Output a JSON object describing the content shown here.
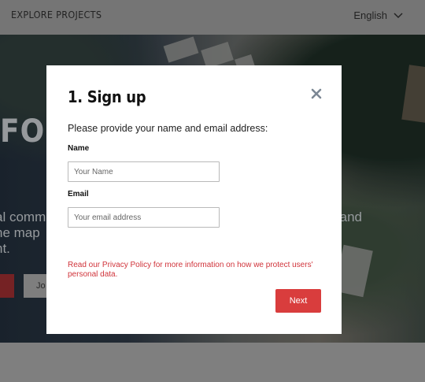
{
  "header": {
    "brand": "EXPLORE PROJECTS",
    "language": "English"
  },
  "hero": {
    "headline_fragment": "FOR",
    "sub_left_line1": "al comm",
    "sub_left_line2": "ne map",
    "sub_left_line3": "nt.",
    "sub_right": "and",
    "secondary_button_fragment": "Jo"
  },
  "modal": {
    "title": "1. Sign up",
    "intro": "Please provide your name and email address:",
    "name_label": "Name",
    "name_placeholder": "Your Name",
    "name_value": "",
    "email_label": "Email",
    "email_placeholder": "Your email address",
    "email_value": "",
    "privacy_text": "Read our Privacy Policy for more information on how we protect users' personal data.",
    "next_label": "Next"
  },
  "colors": {
    "accent": "#d93d3d",
    "privacy_text": "#d0333a"
  },
  "icons": {
    "close": "close-icon",
    "language_dropdown": "chevron-down-icon"
  }
}
